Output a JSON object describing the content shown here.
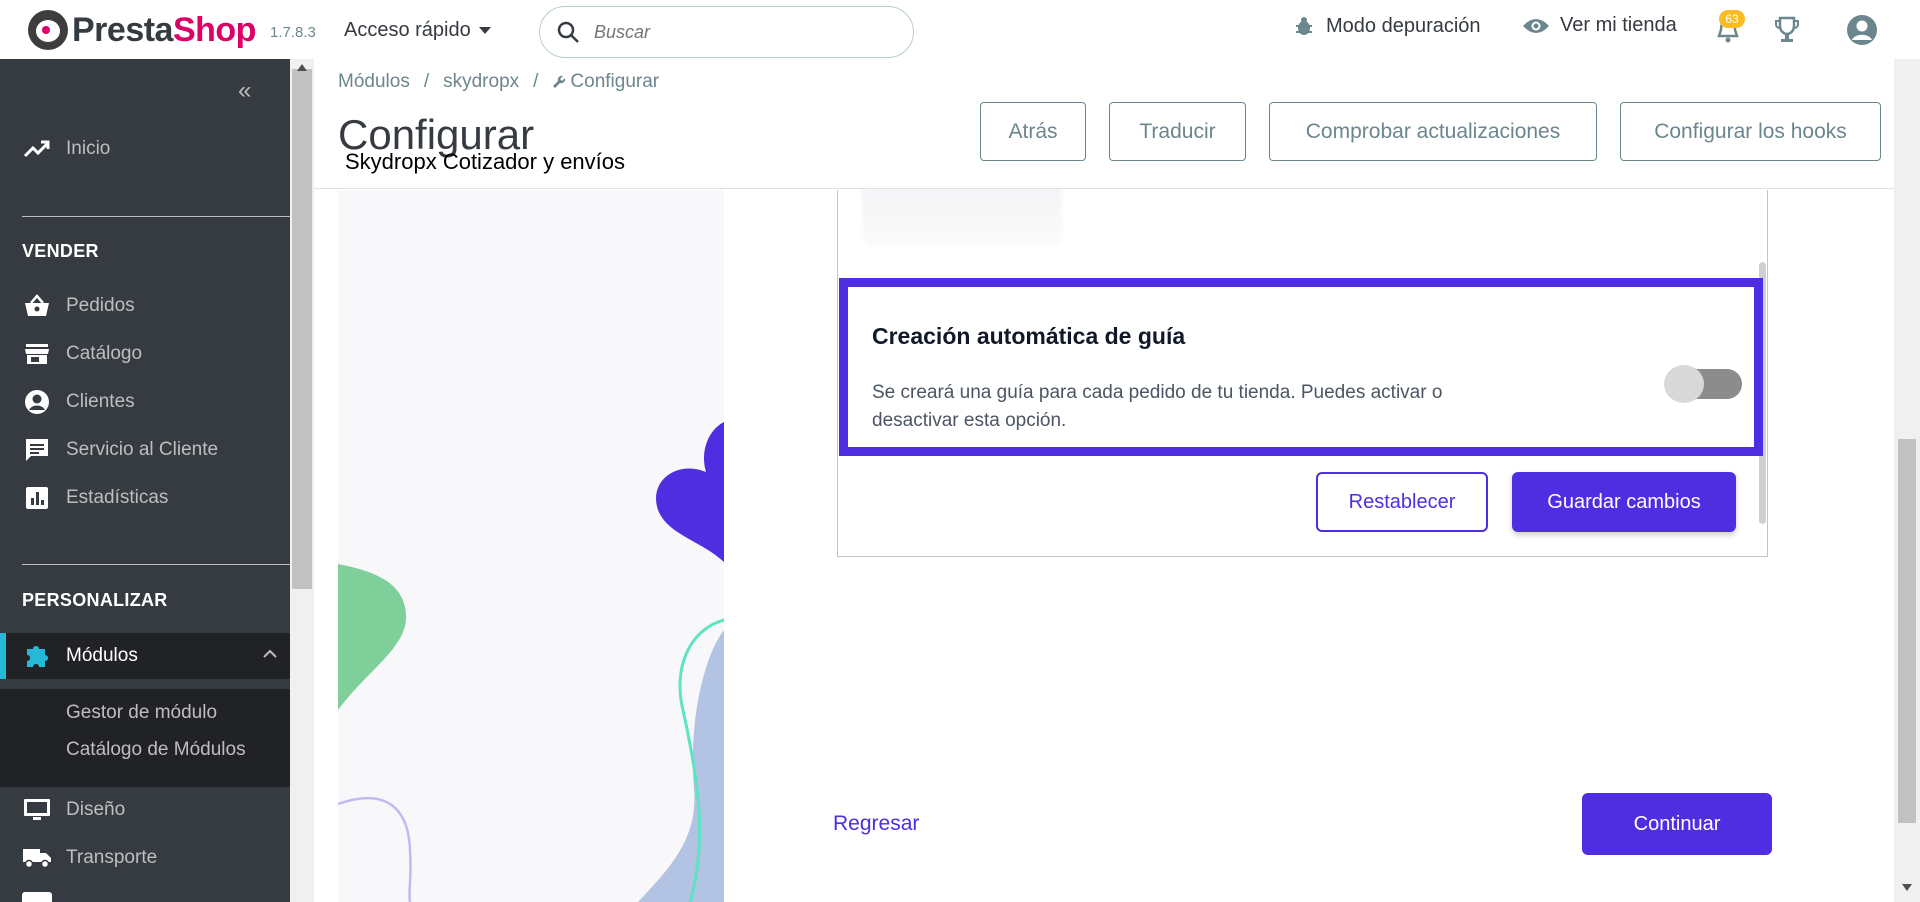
{
  "header": {
    "logo_part1": "Presta",
    "logo_part2": "Shop",
    "version": "1.7.8.3",
    "quick_access": "Acceso rápido",
    "search_placeholder": "Buscar",
    "debug_mode": "Modo depuración",
    "view_store": "Ver mi tienda",
    "notifications_count": "63"
  },
  "sidebar": {
    "home": "Inicio",
    "sell_section": "VENDER",
    "sell_items": [
      "Pedidos",
      "Catálogo",
      "Clientes",
      "Servicio al Cliente",
      "Estadísticas"
    ],
    "customize_section": "PERSONALIZAR",
    "modules": "Módulos",
    "module_sub": [
      "Gestor de módulo",
      "Catálogo de Módulos"
    ],
    "design": "Diseño",
    "shipping": "Transporte"
  },
  "page": {
    "breadcrumb": [
      "Módulos",
      "/",
      "skydropx",
      "/",
      "Configurar"
    ],
    "title": "Configurar",
    "subtitle": "Skydropx Cotizador y envíos",
    "buttons": {
      "back": "Atrás",
      "translate": "Traducir",
      "check_updates": "Comprobar actualizaciones",
      "configure_hooks": "Configurar los hooks"
    }
  },
  "settings": {
    "feature_title": "Creación automática de guía",
    "feature_desc": "Se creará una guía para cada pedido de tu tienda. Puedes activar o desactivar esta opción.",
    "toggle_state": "off",
    "reset": "Restablecer",
    "save": "Guardar cambios",
    "back_link": "Regresar",
    "continue": "Continuar"
  },
  "colors": {
    "accent": "#4f2de1",
    "sidebar_bg": "#363a41",
    "active_border": "#25b9d7"
  }
}
